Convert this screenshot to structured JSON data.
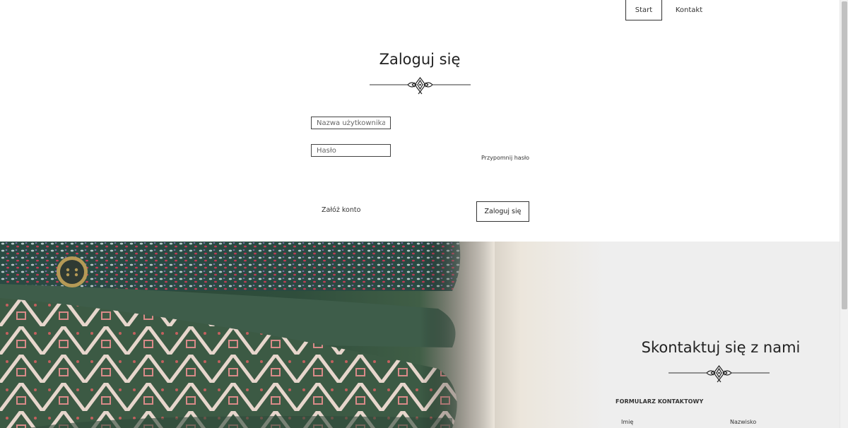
{
  "nav": {
    "items": [
      {
        "label": "Start"
      },
      {
        "label": "Kontakt"
      }
    ]
  },
  "login": {
    "title": "Zaloguj się",
    "username_placeholder": "Nazwa użytkownika",
    "password_placeholder": "Hasło",
    "remind_password": "Przypomnij hasło",
    "register": "Załóż konto",
    "submit": "Zaloguj się"
  },
  "contact": {
    "title": "Skontaktuj się z nami",
    "form_heading": "FORMULARZ KONTAKTOWY",
    "first_name_label": "Imię",
    "last_name_label": "Nazwisko"
  },
  "icons": {
    "ornament": "ornament-divider-icon"
  },
  "colors": {
    "text": "#333333",
    "hero_green": "#2f4e3c",
    "hero_light": "#eeeeee"
  }
}
